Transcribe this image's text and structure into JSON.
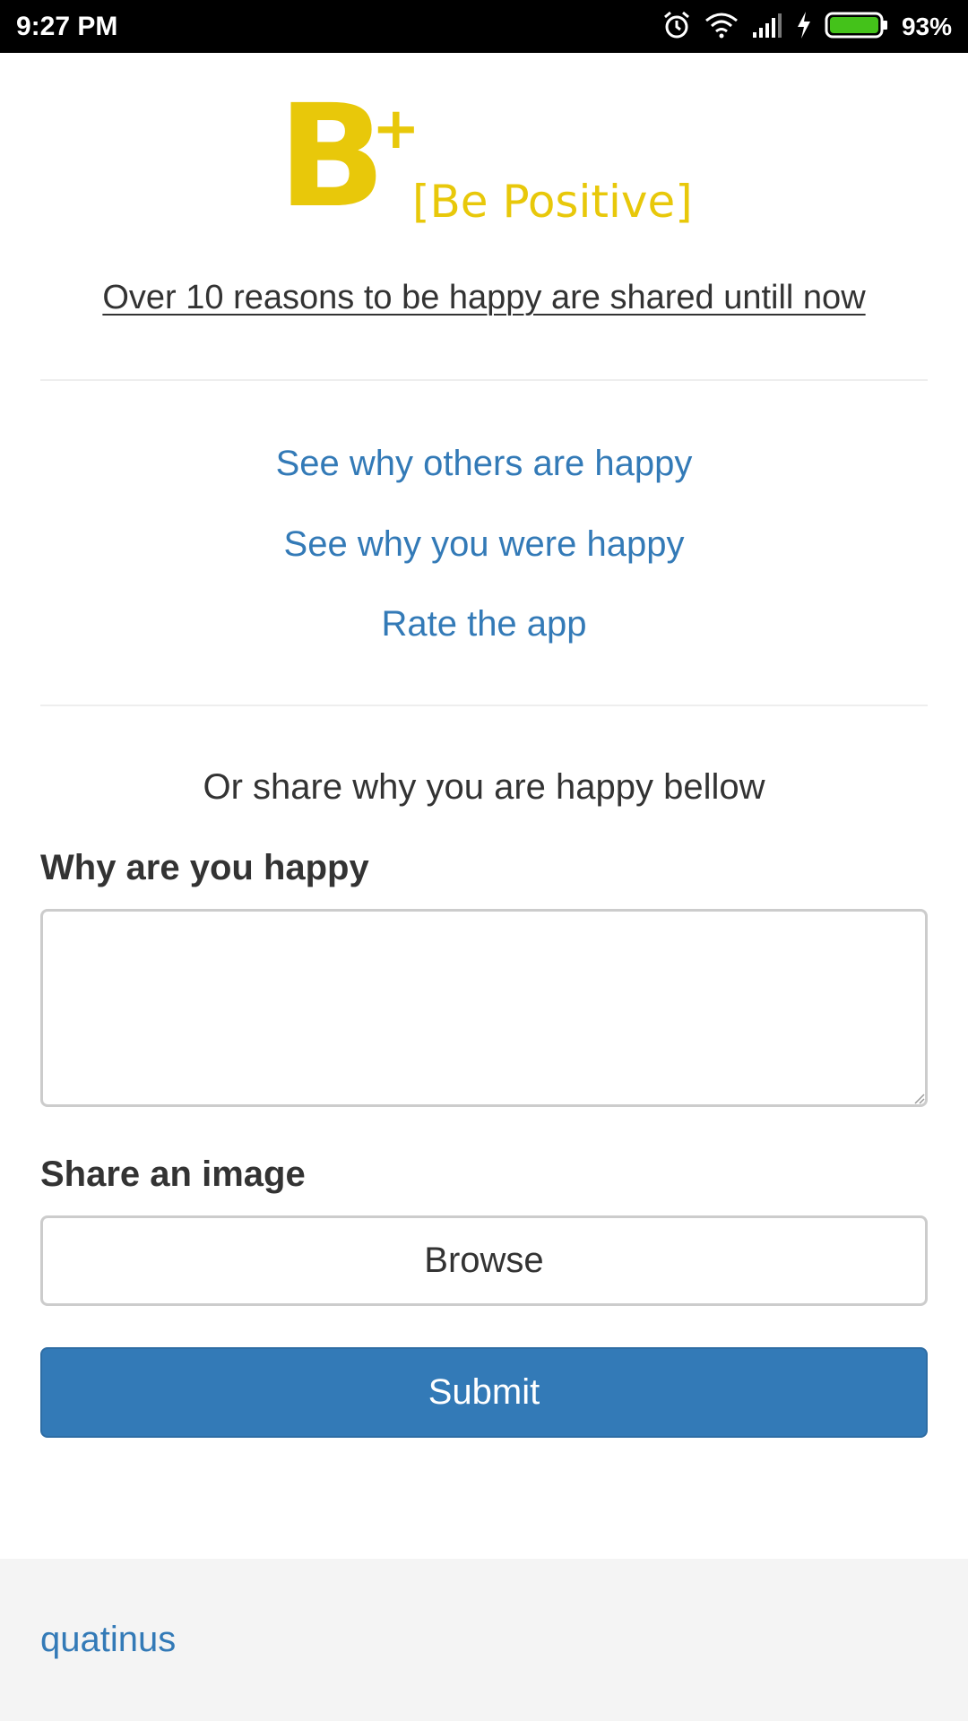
{
  "status_bar": {
    "time": "9:27 PM",
    "battery_percent": "93%",
    "icons": [
      "alarm-icon",
      "wifi-icon",
      "signal-icon",
      "charging-icon",
      "battery-icon"
    ],
    "battery_color": "#44c21a"
  },
  "logo": {
    "letter": "B",
    "superscript": "+",
    "tagline": "[Be Positive]",
    "color": "#e8c80a"
  },
  "headline": "Over 10 reasons to be happy are shared untill now",
  "links": [
    {
      "label": "See why others are happy"
    },
    {
      "label": "See why you were happy"
    },
    {
      "label": "Rate the app"
    }
  ],
  "share_prompt": "Or share why you are happy bellow",
  "form": {
    "why_label": "Why are you happy",
    "why_value": "",
    "image_label": "Share an image",
    "browse_label": "Browse",
    "submit_label": "Submit"
  },
  "footer": {
    "link_label": "quatinus"
  },
  "colors": {
    "accent": "#337ab7",
    "text": "#333333"
  }
}
